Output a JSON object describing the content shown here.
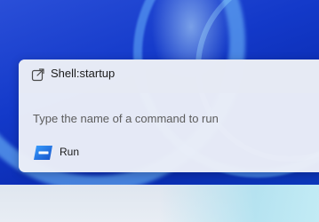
{
  "suggestion": {
    "text": "Shell:startup",
    "icon": "open-external-icon"
  },
  "command": {
    "placeholder": "Type the name of a command to run",
    "value": ""
  },
  "app": {
    "label": "Run",
    "icon": "run-app-icon"
  },
  "colors": {
    "panel_bg": "#ecf0f8",
    "desktop_blue": "#1339c9",
    "run_icon_blue": "#1f6fd6"
  }
}
